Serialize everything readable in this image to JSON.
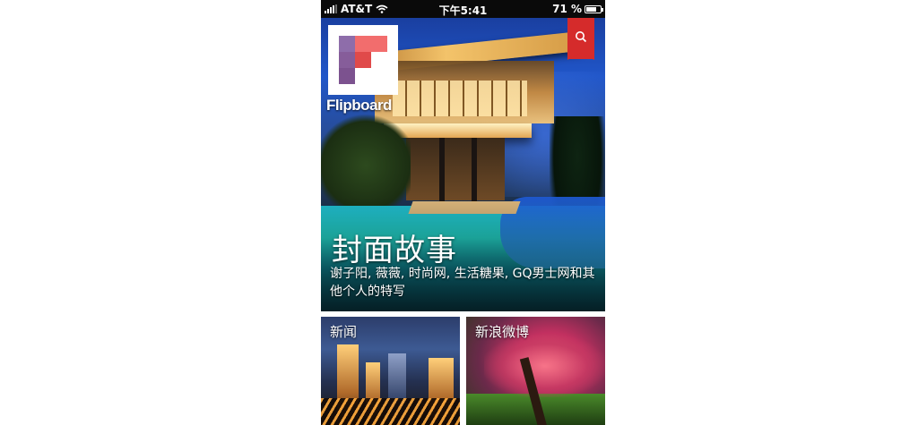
{
  "status_bar": {
    "carrier": "AT&T",
    "time": "下午5:41",
    "battery_percent": "71 %",
    "battery_level": 0.71,
    "signal_icon": "signal-bars-icon",
    "wifi_icon": "wifi-icon",
    "battery_icon": "battery-icon"
  },
  "app": {
    "logo_text": "Flipboard",
    "search_icon": "search-icon"
  },
  "cover_story": {
    "title": "封面故事",
    "subtitle": "谢子阳, 薇薇, 时尚网, 生活糖果, GQ男士网和其他个人的特写"
  },
  "tiles": [
    {
      "label": "新闻"
    },
    {
      "label": "新浪微博"
    }
  ],
  "colors": {
    "search_tab": "#d52b2b",
    "status_bar": "#0a0a0a"
  }
}
